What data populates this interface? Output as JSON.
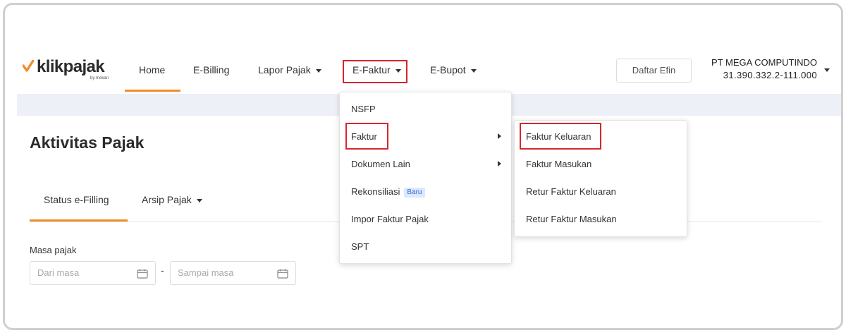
{
  "logo": {
    "text": "klikpajak",
    "sub": "by mekari",
    "brand_color": "#f28c28"
  },
  "nav": {
    "home": "Home",
    "ebilling": "E-Billing",
    "lapor_pajak": "Lapor Pajak",
    "efaktur": "E-Faktur",
    "ebupot": "E-Bupot",
    "active": "Home"
  },
  "header": {
    "daftar_efin": "Daftar Efin",
    "company_name": "PT MEGA COMPUTINDO",
    "company_npwp": "31.390.332.2-111.000"
  },
  "page": {
    "title": "Aktivitas Pajak",
    "tabs": [
      {
        "label": "Status e-Filling",
        "active": true
      },
      {
        "label": "Arsip Pajak",
        "dropdown": true
      }
    ],
    "masa_label": "Masa pajak",
    "from_placeholder": "Dari masa",
    "to_placeholder": "Sampai masa",
    "separator": "-"
  },
  "efaktur_menu": {
    "items": [
      {
        "label": "NSFP"
      },
      {
        "label": "Faktur",
        "submenu": true
      },
      {
        "label": "Dokumen Lain",
        "submenu": true
      },
      {
        "label": "Rekonsiliasi",
        "badge": "Baru"
      },
      {
        "label": "Impor Faktur Pajak"
      },
      {
        "label": "SPT"
      }
    ]
  },
  "faktur_submenu": {
    "items": [
      {
        "label": "Faktur Keluaran"
      },
      {
        "label": "Faktur Masukan"
      },
      {
        "label": "Retur Faktur Keluaran"
      },
      {
        "label": "Retur Faktur Masukan"
      }
    ]
  },
  "highlight_color": "#d6262c"
}
